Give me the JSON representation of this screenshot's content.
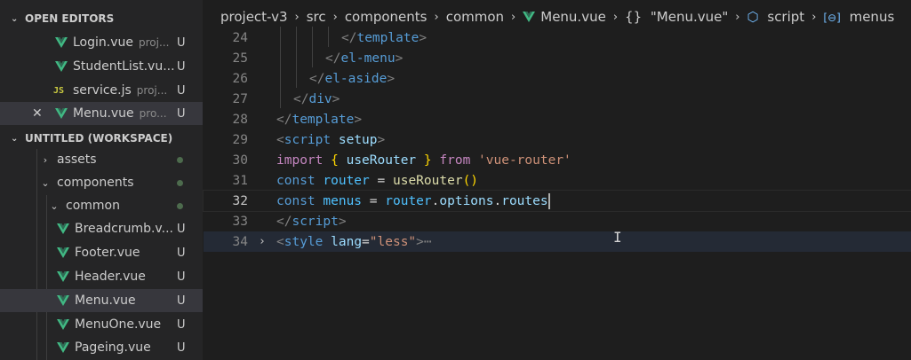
{
  "colors": {
    "vue": "#41b883",
    "js": "#cbcb41",
    "keyword": "#c586c0",
    "tag": "#569cd6",
    "string": "#ce9178"
  },
  "open_editors": {
    "title": "OPEN EDITORS",
    "items": [
      {
        "icon": "vue-icon",
        "name": "Login.vue",
        "dim": "proj...",
        "badge": "U"
      },
      {
        "icon": "vue-icon",
        "name": "StudentList.vu...",
        "dim": "",
        "badge": "U"
      },
      {
        "icon": "js-icon",
        "icon_text": "JS",
        "name": "service.js",
        "dim": "proj...",
        "badge": "U"
      },
      {
        "icon": "vue-icon",
        "name": "Menu.vue",
        "dim": "pro...",
        "badge": "U",
        "close": "✕"
      }
    ]
  },
  "workspace": {
    "title": "UNTITLED (WORKSPACE)",
    "folders": [
      {
        "chevron": "›",
        "name": "assets"
      },
      {
        "chevron": "⌄",
        "name": "components"
      },
      {
        "chevron": "⌄",
        "name": "common"
      }
    ],
    "files": [
      {
        "name": "Breadcrumb.v...",
        "badge": "U"
      },
      {
        "name": "Footer.vue",
        "badge": "U"
      },
      {
        "name": "Header.vue",
        "badge": "U"
      },
      {
        "name": "Menu.vue",
        "badge": "U"
      },
      {
        "name": "MenuOne.vue",
        "badge": "U"
      },
      {
        "name": "Pageing.vue",
        "badge": "U"
      }
    ]
  },
  "breadcrumb": {
    "parts": [
      "project-v3",
      "src",
      "components",
      "common",
      "Menu.vue",
      "\"Menu.vue\"",
      "script",
      "menus"
    ],
    "sep": "›",
    "obj_icon": "{}",
    "script_icon": "⬡",
    "var_icon": "[⊖]"
  },
  "editor": {
    "line_numbers": [
      "24",
      "25",
      "26",
      "27",
      "28",
      "29",
      "30",
      "31",
      "32",
      "33",
      "34"
    ],
    "ellipsis": "⋯",
    "fold": "›",
    "code": {
      "l24_tag": "template",
      "l25_tag": "el-menu",
      "l26_tag": "el-aside",
      "l27_tag": "div",
      "l28_tag": "template",
      "l29_tag": "script",
      "l29_attr": "setup",
      "l30_import": "import",
      "l30_name": "useRouter",
      "l30_from": "from",
      "l30_src": "'vue-router'",
      "l31_const": "const",
      "l31_var": "router",
      "l31_fn": "useRouter",
      "l32_const": "const",
      "l32_var": "menus",
      "l32_obj": "router",
      "l32_p1": "options",
      "l32_p2": "routes",
      "l33_tag": "script",
      "l34_tag": "style",
      "l34_attr": "lang",
      "l34_val": "\"less\""
    }
  }
}
